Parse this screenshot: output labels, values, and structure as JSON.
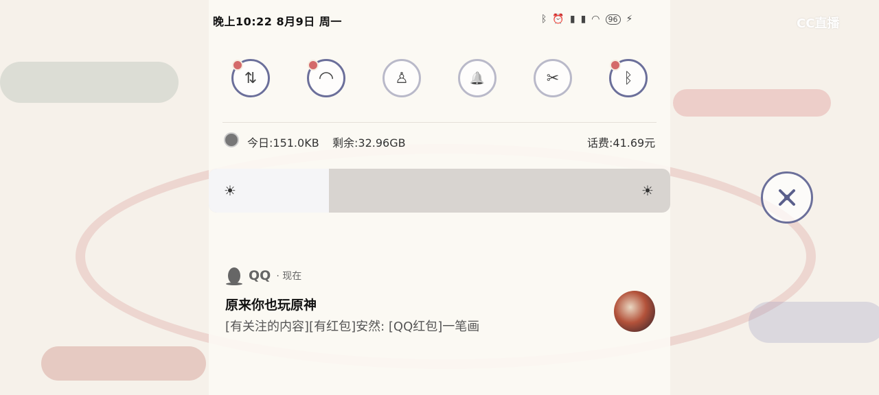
{
  "status_bar": {
    "time_date": "晚上10:22 8月9日 周一",
    "icons": [
      "bluetooth-icon",
      "alarm-icon",
      "signal-hd-icon",
      "signal-hd-icon",
      "wifi-icon",
      "battery-icon",
      "charging-icon"
    ],
    "battery": "96"
  },
  "watermark": "CC直播",
  "quick_toggles": [
    {
      "name": "mobile-data-icon",
      "glyph": "⇅",
      "active": true
    },
    {
      "name": "wifi-icon",
      "glyph": "◠",
      "active": true
    },
    {
      "name": "flashlight-icon",
      "glyph": "♙",
      "active": false
    },
    {
      "name": "bell-icon",
      "glyph": "🔔",
      "active": false
    },
    {
      "name": "screenshot-icon",
      "glyph": "✂",
      "active": false
    },
    {
      "name": "bluetooth-icon",
      "glyph": "ᛒ",
      "active": true
    }
  ],
  "usage": {
    "today": "今日:151.0KB",
    "remaining": "剩余:32.96GB",
    "balance": "话费:41.69元"
  },
  "brightness": {
    "level": 0.26
  },
  "notification": {
    "app": "QQ",
    "time": "· 现在",
    "title": "原来你也玩原神",
    "body": "[有关注的内容][有红包]安然: [QQ红包]一笔画"
  },
  "colors": {
    "accent": "#6b6f9a",
    "badge": "#d46a6a"
  }
}
